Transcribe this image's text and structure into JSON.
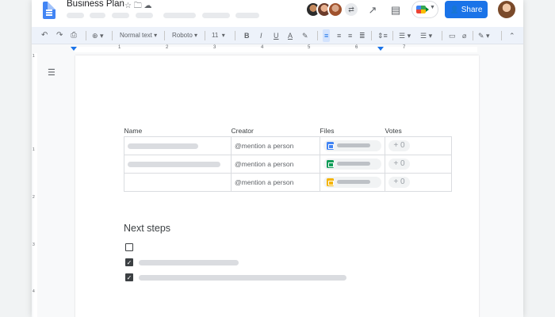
{
  "header": {
    "doc_title": "Business Plan",
    "title_icons": "☆ 🗀 ☁",
    "share_label": "Share",
    "share_icon": "person-add-icon",
    "more_collaborators_icon": "chevron-left-icon"
  },
  "toolbar": {
    "zoom_icon": "⊕",
    "style": "Normal text",
    "font": "Roboto",
    "size": "11",
    "undo": "↶",
    "redo": "↷",
    "print": "⎙",
    "bold": "B",
    "italic": "I",
    "underline": "U",
    "text_color": "A",
    "highlight": "✎",
    "more_label": "more-vert"
  },
  "ruler": {
    "numbers": [
      "1",
      "2",
      "3",
      "4",
      "5",
      "6",
      "7"
    ]
  },
  "vruler": {
    "numbers": [
      "1",
      "1",
      "2",
      "3",
      "4"
    ]
  },
  "table": {
    "headers": {
      "name": "Name",
      "creator": "Creator",
      "files": "Files",
      "votes": "Votes"
    },
    "rows": [
      {
        "creator": "@mention a person",
        "file_type": "docs",
        "file_color": "#4285f4",
        "votes": "+ 0"
      },
      {
        "creator": "@mention a person",
        "file_type": "sheets",
        "file_color": "#0f9d58",
        "votes": "+ 0"
      },
      {
        "creator": "@mention a person",
        "file_type": "slides",
        "file_color": "#f4b400",
        "votes": "+ 0"
      }
    ]
  },
  "next_steps": {
    "heading": "Next steps",
    "items": [
      {
        "checked": false
      },
      {
        "checked": true
      },
      {
        "checked": true
      }
    ]
  },
  "colors": {
    "accent": "#1a73e8",
    "docs_blue": "#4285f4",
    "sheets_green": "#0f9d58",
    "slides_yellow": "#f4b400"
  }
}
